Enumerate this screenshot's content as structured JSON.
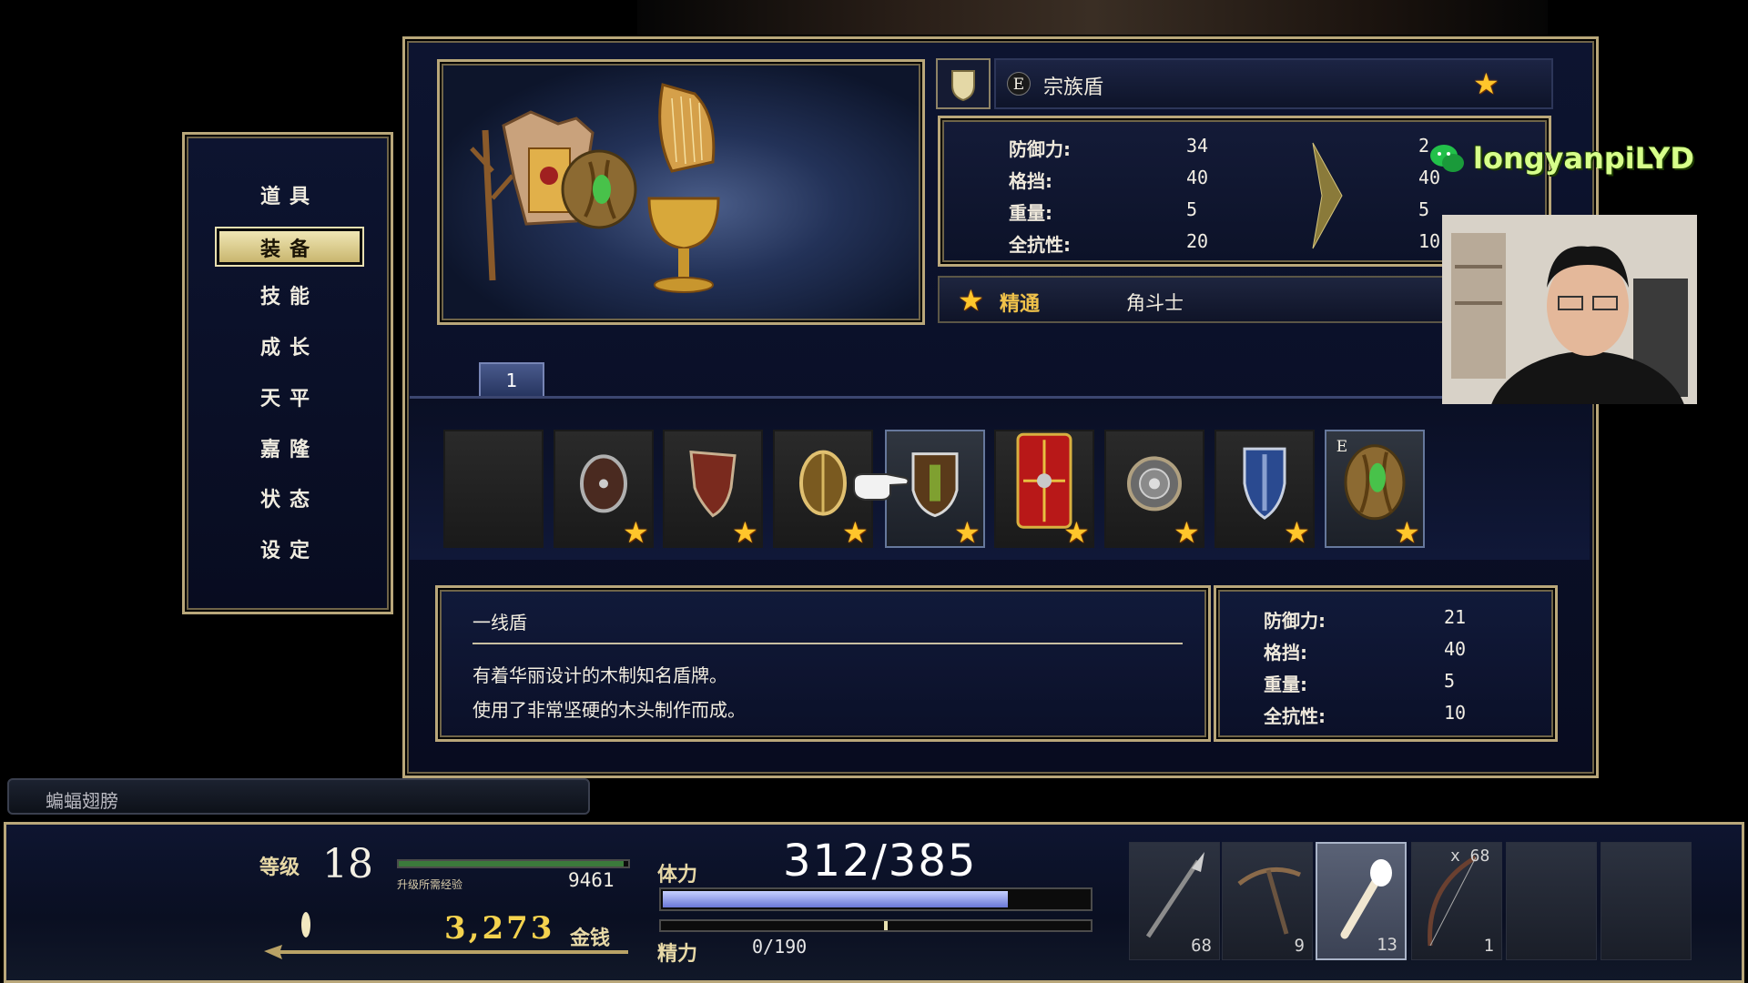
{
  "menu": {
    "items": [
      {
        "label": "道具",
        "active": false
      },
      {
        "label": "装备",
        "active": true
      },
      {
        "label": "技能",
        "active": false
      },
      {
        "label": "成长",
        "active": false
      },
      {
        "label": "天平",
        "active": false
      },
      {
        "label": "嘉隆",
        "active": false
      },
      {
        "label": "状态",
        "active": false
      },
      {
        "label": "设定",
        "active": false
      }
    ]
  },
  "equipped": {
    "badge": "E",
    "name": "宗族盾",
    "stats": [
      {
        "label": "防御力:",
        "current": "34",
        "new": "2"
      },
      {
        "label": "格挡:",
        "current": "40",
        "new": "40"
      },
      {
        "label": "重量:",
        "current": "5",
        "new": "5"
      },
      {
        "label": "全抗性:",
        "current": "20",
        "new": "10"
      }
    ],
    "mastery_label": "精通",
    "mastery_class": "角斗士"
  },
  "tabs": [
    {
      "label": "1"
    }
  ],
  "shields": [
    {
      "icon": "empty-slot",
      "star": false
    },
    {
      "icon": "round-buckler-icon",
      "star": true
    },
    {
      "icon": "heater-shield-icon",
      "star": true
    },
    {
      "icon": "oval-shield-icon",
      "star": true
    },
    {
      "icon": "wooden-shield-icon",
      "star": true,
      "selected": true
    },
    {
      "icon": "roman-scutum-icon",
      "star": true
    },
    {
      "icon": "round-steel-shield-icon",
      "star": true
    },
    {
      "icon": "blue-kite-shield-icon",
      "star": true
    },
    {
      "icon": "clan-shield-icon",
      "star": true,
      "equipped": "E"
    }
  ],
  "description": {
    "title": "一线盾",
    "line1": "有着华丽设计的木制知名盾牌。",
    "line2": "使用了非常坚硬的木头制作而成。",
    "stats": [
      {
        "label": "防御力:",
        "value": "21"
      },
      {
        "label": "格挡:",
        "value": "40"
      },
      {
        "label": "重量:",
        "value": "5"
      },
      {
        "label": "全抗性:",
        "value": "10"
      }
    ]
  },
  "status": {
    "held_item": "蝙蝠翅膀",
    "level_label": "等级",
    "level": "18",
    "exp_label": "升级所需经验",
    "exp": "9461",
    "exp_progress": 0.98,
    "gold": "3,273",
    "gold_label": "金钱",
    "hp_label": "体力",
    "hp": "312/385",
    "hp_fraction": 0.81,
    "sp_label": "精力",
    "sp": "0/190",
    "sp_fraction": 0.0
  },
  "quick_items": [
    {
      "icon": "spear-icon",
      "count": "68"
    },
    {
      "icon": "pickaxe-icon",
      "count": "9"
    },
    {
      "icon": "torch-icon",
      "count": "13",
      "selected": true
    },
    {
      "icon": "bow-icon",
      "count": "1",
      "ammo": "x 68"
    },
    {
      "icon": "empty-slot",
      "count": ""
    },
    {
      "icon": "empty-slot",
      "count": ""
    }
  ],
  "overlay": {
    "watermark": "longyanpiLYD"
  },
  "colors": {
    "gold_border": "#b9a77a",
    "star": "#ffc62b",
    "hp_bar": "#8ea0ee",
    "panel": "#0d1430"
  }
}
